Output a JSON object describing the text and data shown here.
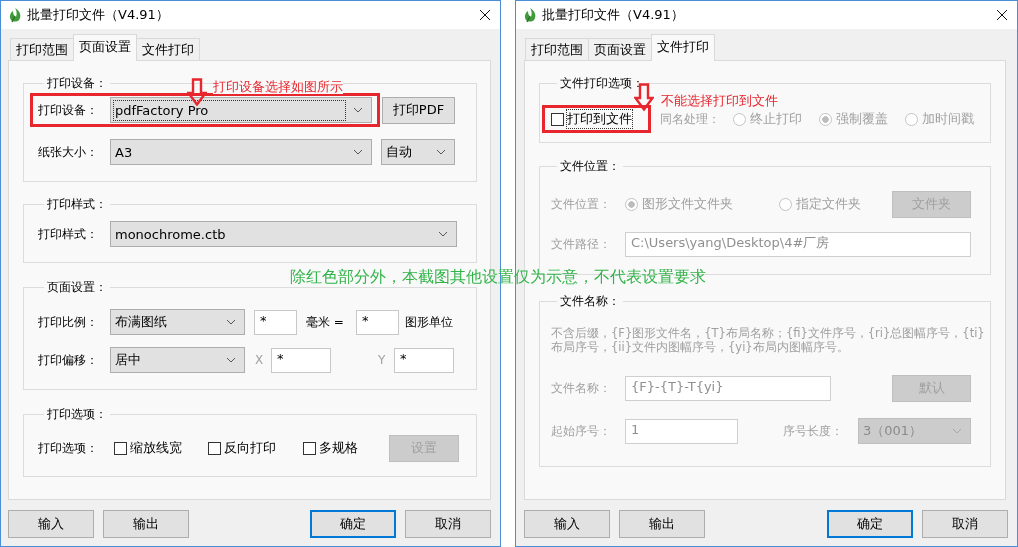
{
  "windows": [
    {
      "title": "批量打印文件（V4.91）",
      "tabs": [
        {
          "label": "打印范围",
          "selected": false
        },
        {
          "label": "页面设置",
          "selected": true
        },
        {
          "label": "文件打印",
          "selected": false
        }
      ],
      "groups": [
        {
          "title": "打印设备：",
          "callout": {
            "text": "打印设备选择如图所示"
          },
          "rows": [
            {
              "items": [
                {
                  "kind": "frame",
                  "items": [
                    {
                      "kind": "label",
                      "text": "打印设备：",
                      "disabled": false
                    },
                    {
                      "kind": "combo",
                      "value": "pdfFactory Pro",
                      "disabled": false,
                      "focused": true
                    }
                  ]
                },
                {
                  "kind": "button",
                  "text": "打印PDF",
                  "disabled": false,
                  "focused": false
                }
              ]
            },
            {
              "items": [
                {
                  "kind": "label",
                  "text": "纸张大小：",
                  "disabled": false
                },
                {
                  "kind": "combo",
                  "value": "A3",
                  "disabled": false,
                  "focused": false
                },
                {
                  "kind": "combo",
                  "value": "自动",
                  "disabled": false,
                  "focused": false
                }
              ]
            }
          ]
        },
        {
          "title": "打印样式：",
          "rows": [
            {
              "items": [
                {
                  "kind": "label",
                  "text": "打印样式：",
                  "disabled": false
                },
                {
                  "kind": "combo",
                  "value": "monochrome.ctb",
                  "disabled": false,
                  "focused": false
                }
              ]
            }
          ]
        },
        {
          "title": "页面设置：",
          "rows": [
            {
              "items": [
                {
                  "kind": "label",
                  "text": "打印比例：",
                  "disabled": false
                },
                {
                  "kind": "combo",
                  "value": "布满图纸",
                  "disabled": false,
                  "focused": false
                },
                {
                  "kind": "field",
                  "value": "*",
                  "disabled": false
                },
                {
                  "kind": "label",
                  "text": "毫米 =",
                  "disabled": false
                },
                {
                  "kind": "field",
                  "value": "*",
                  "disabled": false
                },
                {
                  "kind": "label",
                  "text": "图形单位",
                  "disabled": false
                }
              ]
            },
            {
              "items": [
                {
                  "kind": "label",
                  "text": "打印偏移：",
                  "disabled": false
                },
                {
                  "kind": "combo",
                  "value": "居中",
                  "disabled": false,
                  "focused": false
                },
                {
                  "kind": "label",
                  "text": "X",
                  "disabled": true
                },
                {
                  "kind": "field",
                  "value": "*",
                  "disabled": false
                },
                {
                  "kind": "label",
                  "text": "Y",
                  "disabled": true
                },
                {
                  "kind": "field",
                  "value": "*",
                  "disabled": false
                }
              ]
            }
          ]
        },
        {
          "title": "打印选项：",
          "rows": [
            {
              "items": [
                {
                  "kind": "label",
                  "text": "打印选项：",
                  "disabled": false
                },
                {
                  "kind": "checkbox",
                  "text": "缩放线宽",
                  "checked": false,
                  "disabled": false,
                  "focused": false
                },
                {
                  "kind": "checkbox",
                  "text": "反向打印",
                  "checked": false,
                  "disabled": false,
                  "focused": false
                },
                {
                  "kind": "checkbox",
                  "text": "多规格",
                  "checked": false,
                  "disabled": false,
                  "focused": false
                },
                {
                  "kind": "button",
                  "text": "设置",
                  "disabled": true,
                  "focused": false
                }
              ]
            }
          ]
        }
      ],
      "buttons": [
        {
          "text": "输入",
          "focused": false
        },
        {
          "text": "输出",
          "focused": false
        },
        {
          "text": "确定",
          "focused": true
        },
        {
          "text": "取消",
          "focused": false
        }
      ]
    },
    {
      "title": "批量打印文件（V4.91）",
      "tabs": [
        {
          "label": "打印范围",
          "selected": false
        },
        {
          "label": "页面设置",
          "selected": false
        },
        {
          "label": "文件打印",
          "selected": true
        }
      ],
      "groups": [
        {
          "title": "文件打印选项：",
          "callout": {
            "text": "不能选择打印到文件"
          },
          "rows": [
            {
              "items": [
                {
                  "kind": "frame",
                  "items": [
                    {
                      "kind": "checkbox",
                      "text": "打印到文件",
                      "checked": false,
                      "disabled": false,
                      "focused": true
                    }
                  ]
                },
                {
                  "kind": "label",
                  "text": "同名处理：",
                  "disabled": true
                },
                {
                  "kind": "radio",
                  "text": "终止打印",
                  "selected": false,
                  "disabled": true
                },
                {
                  "kind": "radio",
                  "text": "强制覆盖",
                  "selected": true,
                  "disabled": true
                },
                {
                  "kind": "radio",
                  "text": "加时间戳",
                  "selected": false,
                  "disabled": true
                }
              ]
            }
          ]
        },
        {
          "title": "文件位置：",
          "rows": [
            {
              "items": [
                {
                  "kind": "label",
                  "text": "文件位置：",
                  "disabled": true
                },
                {
                  "kind": "radio",
                  "text": "图形文件文件夹",
                  "selected": true,
                  "disabled": true
                },
                {
                  "kind": "radio",
                  "text": "指定文件夹",
                  "selected": false,
                  "disabled": true
                },
                {
                  "kind": "button",
                  "text": "文件夹",
                  "disabled": true,
                  "focused": false
                }
              ]
            },
            {
              "items": [
                {
                  "kind": "label",
                  "text": "文件路径：",
                  "disabled": true
                },
                {
                  "kind": "field",
                  "value": "C:\\Users\\yang\\Desktop\\4#厂房",
                  "disabled": true
                }
              ]
            }
          ]
        },
        {
          "title": "文件名称：",
          "rows": [
            {
              "items": [
                {
                  "kind": "note",
                  "text": "不含后缀，{F}图形文件名，{T}布局名称；{fi}文件序号，{ri}总图幅序号，{ti}布局序号，{ii}文件内图幅序号，{yi}布局内图幅序号。",
                  "disabled": true
                }
              ]
            },
            {
              "items": [
                {
                  "kind": "label",
                  "text": "文件名称：",
                  "disabled": true
                },
                {
                  "kind": "field",
                  "value": "{F}-{T}-T{yi}",
                  "disabled": true
                },
                {
                  "kind": "button",
                  "text": "默认",
                  "disabled": true,
                  "focused": false
                }
              ]
            },
            {
              "items": [
                {
                  "kind": "label",
                  "text": "起始序号：",
                  "disabled": true
                },
                {
                  "kind": "field",
                  "value": "1",
                  "disabled": true
                },
                {
                  "kind": "label",
                  "text": "序号长度：",
                  "disabled": true
                },
                {
                  "kind": "combo",
                  "value": "3（001）",
                  "disabled": true,
                  "focused": false
                }
              ]
            }
          ]
        }
      ],
      "buttons": [
        {
          "text": "输入",
          "focused": false
        },
        {
          "text": "输出",
          "focused": false
        },
        {
          "text": "确定",
          "focused": true
        },
        {
          "text": "取消",
          "focused": false
        }
      ]
    }
  ],
  "annotation": {
    "text": "除红色部分外，本截图其他设置仅为示意，不代表设置要求"
  }
}
